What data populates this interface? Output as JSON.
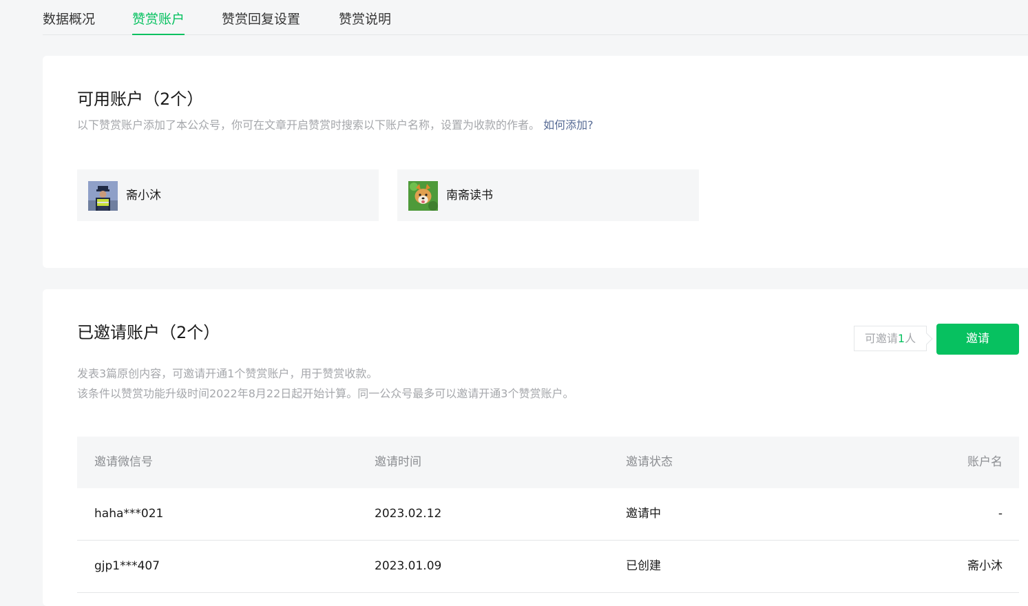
{
  "tabs": [
    {
      "label": "数据概况"
    },
    {
      "label": "赞赏账户"
    },
    {
      "label": "赞赏回复设置"
    },
    {
      "label": "赞赏说明"
    }
  ],
  "active_tab": "赞赏账户",
  "available": {
    "title": "可用账户（2个）",
    "desc": "以下赞赏账户添加了本公众号，你可在文章开启赞赏时搜索以下账户名称，设置为收款的作者。",
    "help_link": "如何添加?",
    "accounts": [
      {
        "name": "斋小沐",
        "avatar": "police-avatar"
      },
      {
        "name": "南斋读书",
        "avatar": "dog-avatar"
      }
    ]
  },
  "invited": {
    "title": "已邀请账户（2个）",
    "quota_prefix": "可邀请",
    "quota_num": "1",
    "quota_suffix": "人",
    "invite_button": "邀请",
    "desc_line1": "发表3篇原创内容，可邀请开通1个赞赏账户，用于赞赏收款。",
    "desc_line2": "该条件以赞赏功能升级时间2022年8月22日起开始计算。同一公众号最多可以邀请开通3个赞赏账户。",
    "columns": [
      "邀请微信号",
      "邀请时间",
      "邀请状态",
      "账户名"
    ],
    "rows": [
      {
        "wechat": "haha***021",
        "time": "2023.02.12",
        "status": "邀请中",
        "account": "-"
      },
      {
        "wechat": "gjp1***407",
        "time": "2023.01.09",
        "status": "已创建",
        "account": "斋小沐"
      }
    ]
  },
  "colors": {
    "accent": "#07c160",
    "link": "#576b95",
    "muted": "#a5a7ab",
    "background": "#f5f6f7"
  }
}
